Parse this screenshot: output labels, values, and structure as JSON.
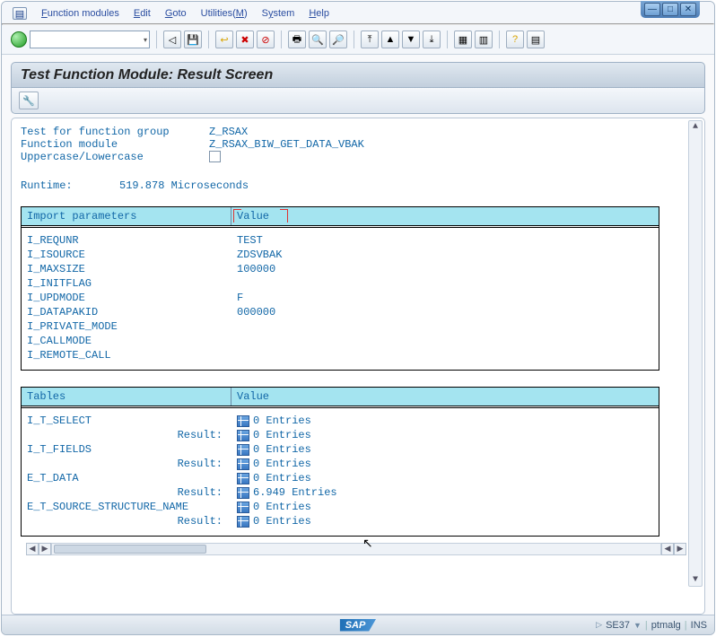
{
  "menu": {
    "function_modules": "Function modules",
    "edit": "Edit",
    "goto": "Goto",
    "utilities": "Utilities(M)",
    "system": "System",
    "help": "Help"
  },
  "title": "Test Function Module: Result Screen",
  "info": {
    "group_label": "Test for function group",
    "group_value": "Z_RSAX",
    "fm_label": "Function module",
    "fm_value": "Z_RSAX_BIW_GET_DATA_VBAK",
    "case_label": "Uppercase/Lowercase"
  },
  "runtime": {
    "label": "Runtime:",
    "value": "519.878 Microseconds"
  },
  "import_header": {
    "col1": "Import parameters",
    "col2": "Value"
  },
  "import_params": [
    {
      "name": "I_REQUNR",
      "value": "TEST"
    },
    {
      "name": "I_ISOURCE",
      "value": "ZDSVBAK"
    },
    {
      "name": "I_MAXSIZE",
      "value": "100000"
    },
    {
      "name": "I_INITFLAG",
      "value": ""
    },
    {
      "name": "I_UPDMODE",
      "value": "F"
    },
    {
      "name": "I_DATAPAKID",
      "value": "000000"
    },
    {
      "name": "I_PRIVATE_MODE",
      "value": ""
    },
    {
      "name": "I_CALLMODE",
      "value": ""
    },
    {
      "name": "I_REMOTE_CALL",
      "value": ""
    }
  ],
  "tables_header": {
    "col1": "Tables",
    "col2": "Value"
  },
  "result_label": "Result:",
  "tables": [
    {
      "name": "I_T_SELECT",
      "entries": "0 Entries",
      "result": "0 Entries"
    },
    {
      "name": "I_T_FIELDS",
      "entries": "0 Entries",
      "result": "0 Entries"
    },
    {
      "name": "E_T_DATA",
      "entries": "0 Entries",
      "result": "6.949 Entries"
    },
    {
      "name": "E_T_SOURCE_STRUCTURE_NAME",
      "entries": "0 Entries",
      "result": "0 Entries"
    }
  ],
  "status": {
    "tcode": "SE37",
    "user": "ptmalg",
    "mode": "INS"
  },
  "logo": "SAP"
}
